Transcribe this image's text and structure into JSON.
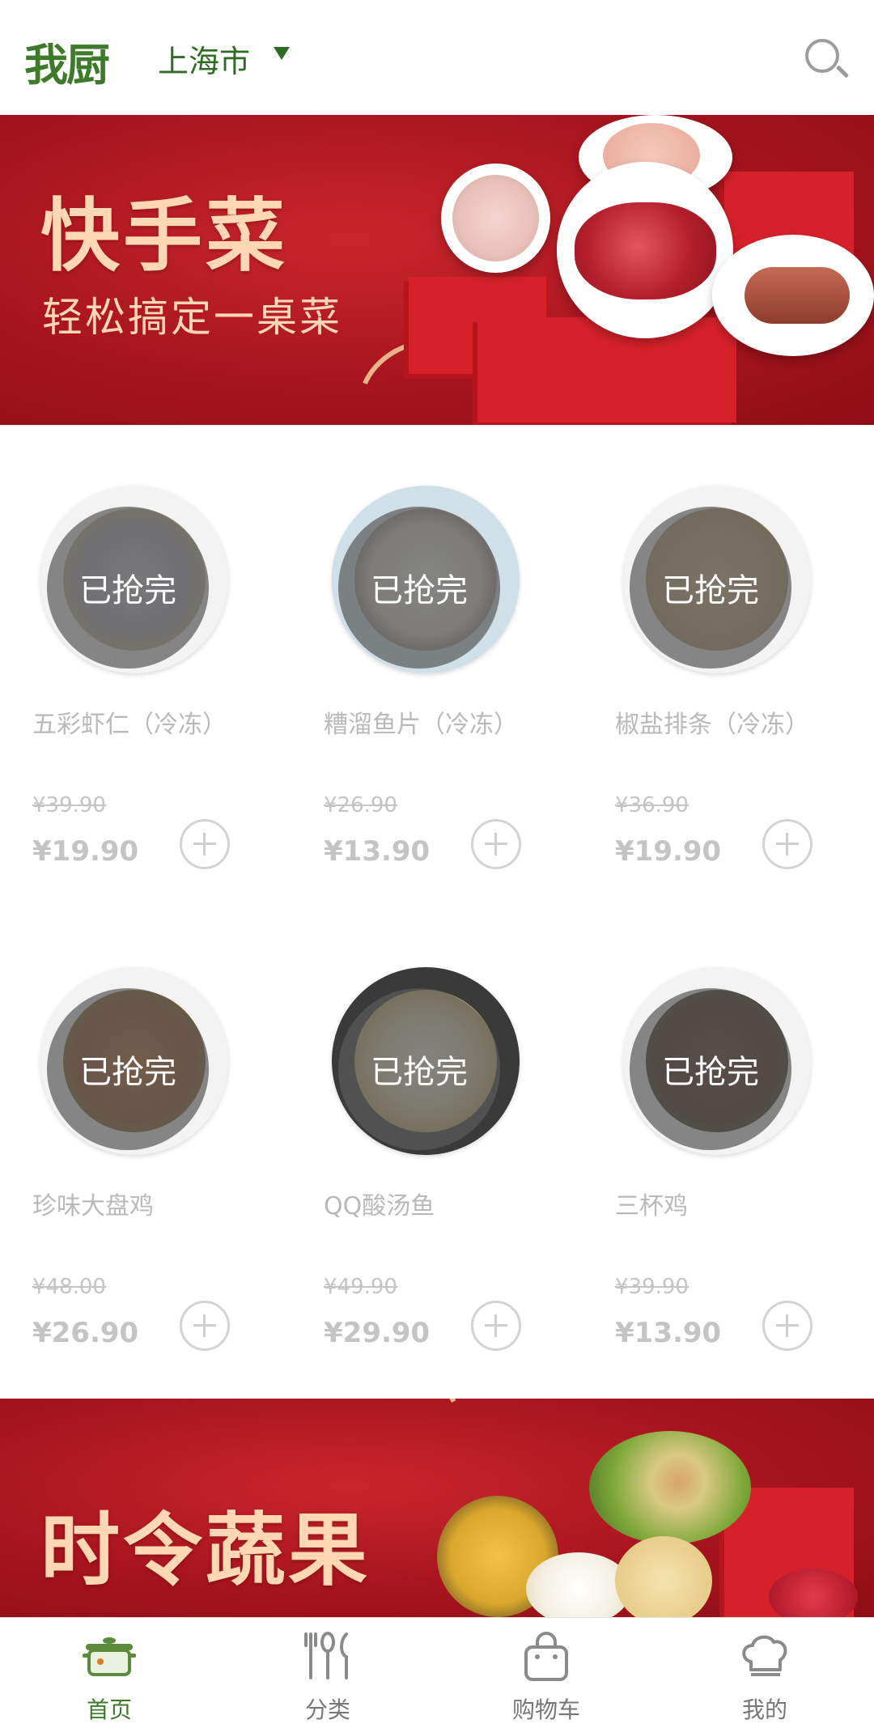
{
  "header": {
    "logo_text": "我厨",
    "city": "上海市"
  },
  "banners": [
    {
      "title": "快手菜",
      "subtitle": "轻松搞定一桌菜"
    },
    {
      "title": "时令蔬果",
      "subtitle": ""
    }
  ],
  "sold_out_label": "已抢完",
  "products": [
    {
      "name": "五彩虾仁（冷冻）",
      "original_price": "¥39.90",
      "price": "¥19.90"
    },
    {
      "name": "糟溜鱼片（冷冻）",
      "original_price": "¥26.90",
      "price": "¥13.90"
    },
    {
      "name": "椒盐排条（冷冻）",
      "original_price": "¥36.90",
      "price": "¥19.90"
    },
    {
      "name": "珍味大盘鸡",
      "original_price": "¥48.00",
      "price": "¥26.90"
    },
    {
      "name": "QQ酸汤鱼",
      "original_price": "¥49.90",
      "price": "¥29.90"
    },
    {
      "name": "三杯鸡",
      "original_price": "¥39.90",
      "price": "¥13.90"
    }
  ],
  "tabbar": [
    {
      "label": "首页",
      "icon": "pot-icon",
      "active": true
    },
    {
      "label": "分类",
      "icon": "utensils-icon",
      "active": false
    },
    {
      "label": "购物车",
      "icon": "shopping-bag-icon",
      "active": false
    },
    {
      "label": "我的",
      "icon": "chef-hat-icon",
      "active": false
    }
  ],
  "colors": {
    "brand_green": "#3e7a2a",
    "banner_red": "#a7141e",
    "banner_text": "#ffd7b5"
  }
}
